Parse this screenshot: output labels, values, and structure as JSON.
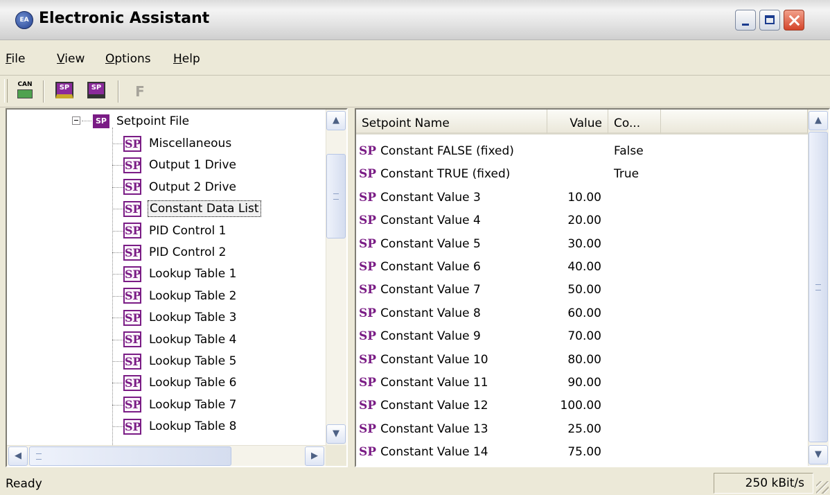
{
  "window": {
    "title": "Electronic Assistant",
    "app_icon_text": "EA"
  },
  "menu": [
    {
      "pre": "",
      "accel": "F",
      "post": "ile"
    },
    {
      "pre": "",
      "accel": "V",
      "post": "iew"
    },
    {
      "pre": "",
      "accel": "O",
      "post": "ptions"
    },
    {
      "pre": "",
      "accel": "H",
      "post": "elp"
    }
  ],
  "toolbar": {
    "can_label": "CAN",
    "open_sp_label": "SP",
    "save_sp_label": "SP",
    "f_label": "F"
  },
  "tree": {
    "root_icon_text": "SP",
    "root_label": "Setpoint File",
    "item_icon_text": "SP",
    "items": [
      "Miscellaneous",
      "Output 1 Drive",
      "Output 2 Drive",
      "Constant Data List",
      "PID Control 1",
      "PID Control 2",
      "Lookup Table 1",
      "Lookup Table 2",
      "Lookup Table 3",
      "Lookup Table 4",
      "Lookup Table 5",
      "Lookup Table 6",
      "Lookup Table 7",
      "Lookup Table 8"
    ],
    "selected_index": 3
  },
  "list": {
    "headers": [
      "Setpoint Name",
      "Value",
      "Co..."
    ],
    "row_icon_text": "SP",
    "rows": [
      {
        "name": "Constant FALSE (fixed)",
        "value": "",
        "co": "False"
      },
      {
        "name": "Constant TRUE (fixed)",
        "value": "",
        "co": "True"
      },
      {
        "name": "Constant Value 3",
        "value": "10.00",
        "co": ""
      },
      {
        "name": "Constant Value 4",
        "value": "20.00",
        "co": ""
      },
      {
        "name": "Constant Value 5",
        "value": "30.00",
        "co": ""
      },
      {
        "name": "Constant Value 6",
        "value": "40.00",
        "co": ""
      },
      {
        "name": "Constant Value 7",
        "value": "50.00",
        "co": ""
      },
      {
        "name": "Constant Value 8",
        "value": "60.00",
        "co": ""
      },
      {
        "name": "Constant Value 9",
        "value": "70.00",
        "co": ""
      },
      {
        "name": "Constant Value 10",
        "value": "80.00",
        "co": ""
      },
      {
        "name": "Constant Value 11",
        "value": "90.00",
        "co": ""
      },
      {
        "name": "Constant Value 12",
        "value": "100.00",
        "co": ""
      },
      {
        "name": "Constant Value 13",
        "value": "25.00",
        "co": ""
      },
      {
        "name": "Constant Value 14",
        "value": "75.00",
        "co": ""
      }
    ]
  },
  "status": {
    "text": "Ready",
    "baud": "250 kBit/s"
  }
}
